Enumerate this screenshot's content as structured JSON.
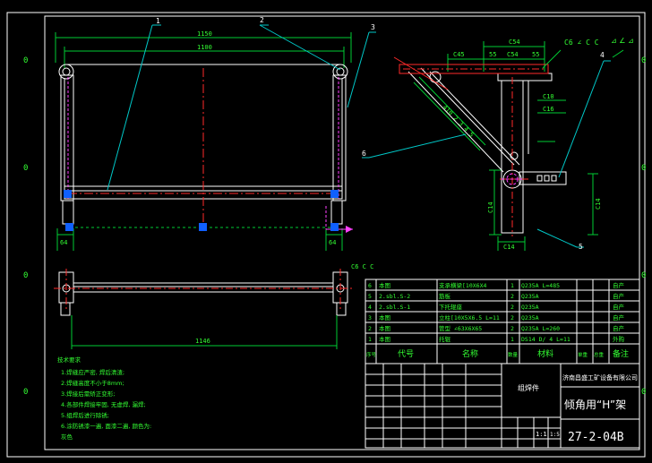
{
  "colors": {
    "background": "#000000",
    "frame": "#ffffff",
    "dimension": "#00cc33",
    "centerline": "#ff2a2a",
    "leader": "#00c8c8",
    "hidden": "#ff40ff",
    "grip": "#1060ff",
    "text_green": "#33ff33",
    "text_white": "#ffffff"
  },
  "border_marks": [
    "0",
    "0",
    "0",
    "0",
    "0",
    "0",
    "0",
    "0"
  ],
  "front_view": {
    "balloons": [
      "1",
      "2",
      "3"
    ],
    "dim_top_outer": "1150",
    "dim_top_inner": "1100",
    "dim_left": "64",
    "dim_right": "64"
  },
  "side_view": {
    "balloons": [
      "4",
      "5",
      "6"
    ],
    "dim_top": "C54",
    "dim_mid_a": "C45",
    "dim_mid_b": "55",
    "dim_mid_c": "C54",
    "dim_mid_d": "55",
    "dim_right_a": "C10",
    "dim_right_b": "C16",
    "dim_diag": "410 2 3 4 5",
    "dim_vert": "C14",
    "dim_vert_r": "C14",
    "dim_bottom": "C14",
    "welding_note": "C6 ∠ C C"
  },
  "bottom_view": {
    "dim_top": "C6 C C",
    "dim_bottom": "1146"
  },
  "notes_title": "技术要求",
  "notes": [
    "1.焊缝应严密, 焊后清渣;",
    "2.焊缝高度不小于8mm;",
    "3.焊接后需矫正变形;",
    "4.各部件焊接牢固, 无虚焊, 漏焊;",
    "5.组焊后进行除锈;",
    "6.涂防锈漆一遍, 面漆二遍, 颜色为:",
    "  灰色"
  ],
  "bom": {
    "rows": [
      {
        "no": "6",
        "code": "本图",
        "name": "支承横梁[10X6X4",
        "qty": "1",
        "material": "Q235A L=485",
        "w1": "",
        "w2": "",
        "note": "自产"
      },
      {
        "no": "5",
        "code": "2.sbl.S-2",
        "name": "筋板",
        "qty": "2",
        "material": "Q235A",
        "w1": "",
        "w2": "",
        "note": "自产"
      },
      {
        "no": "4",
        "code": "2.sbl.S-1",
        "name": "下托辊座",
        "qty": "2",
        "material": "Q235A",
        "w1": "",
        "w2": "",
        "note": "自产"
      },
      {
        "no": "3",
        "code": "本图",
        "name": "立柱[10X5X6.5 L=11",
        "qty": "2",
        "material": "Q235A",
        "w1": "",
        "w2": "",
        "note": "自产"
      },
      {
        "no": "2",
        "code": "本图",
        "name": "管型 ∠63X6X65",
        "qty": "2",
        "material": "Q235A L=260",
        "w1": "",
        "w2": "",
        "note": "自产"
      },
      {
        "no": "1",
        "code": "本图",
        "name": "托辊",
        "qty": "1",
        "material": "DS14 D/ 4 L=11",
        "w1": "",
        "w2": "",
        "note": "外购"
      }
    ],
    "header": {
      "no": "序号",
      "code": "代号",
      "name": "名称",
      "qty": "数量",
      "material": "材料",
      "w1": "单重",
      "w2": "总重",
      "note": "备注"
    }
  },
  "title_block": {
    "company": "济南昌盛工矿设备有限公司",
    "assembly": "组焊件",
    "drawing_name": "倾角用“H”架",
    "drawing_no": "27-2-04B",
    "scale": "1:1",
    "sheet": "1:5"
  }
}
